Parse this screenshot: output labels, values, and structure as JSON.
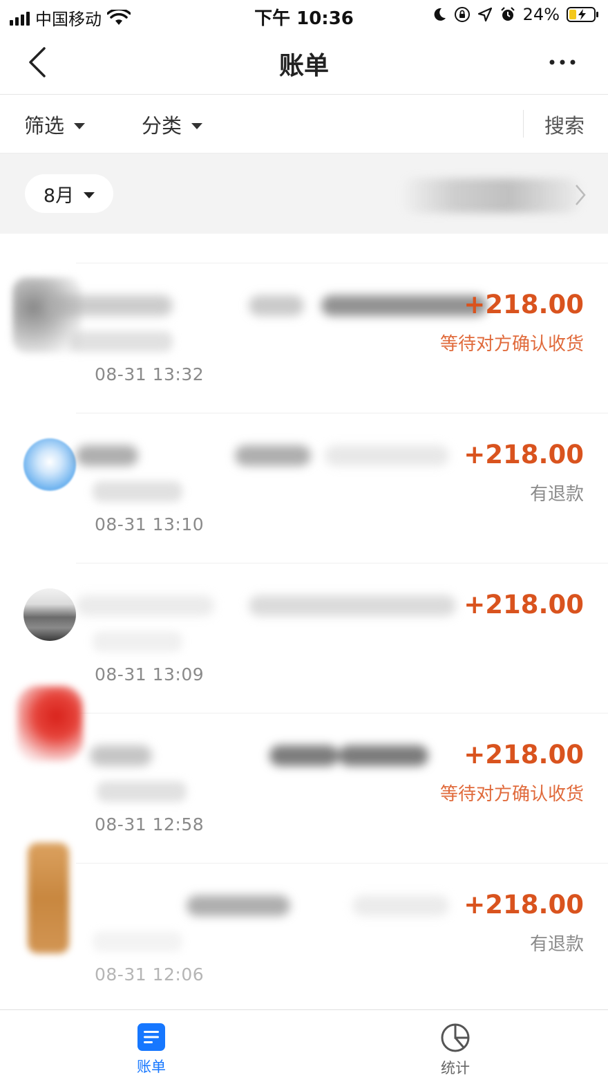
{
  "status_bar": {
    "carrier": "中国移动",
    "time": "下午 10:36",
    "battery_percent": "24%",
    "icons": [
      "signal-icon",
      "wifi-icon",
      "moon-icon",
      "orientation-lock-icon",
      "location-icon",
      "alarm-icon",
      "battery-icon"
    ]
  },
  "nav": {
    "title": "账单",
    "back_icon": "chevron-left-icon",
    "more_icon": "more-dots-icon"
  },
  "filter_bar": {
    "filter_label": "筛选",
    "category_label": "分类",
    "search_label": "搜索"
  },
  "month_bar": {
    "month": "8月"
  },
  "transactions": [
    {
      "amount": "+218.00",
      "status": "等待对方确认收货",
      "status_tone": "orange",
      "time": "08-31  13:32"
    },
    {
      "amount": "+218.00",
      "status": "有退款",
      "status_tone": "grey",
      "time": "08-31  13:10"
    },
    {
      "amount": "+218.00",
      "status": "",
      "status_tone": "none",
      "time": "08-31  13:09"
    },
    {
      "amount": "+218.00",
      "status": "等待对方确认收货",
      "status_tone": "orange",
      "time": "08-31  12:58"
    },
    {
      "amount": "+218.00",
      "status": "有退款",
      "status_tone": "grey",
      "time": "08-31  12:06"
    }
  ],
  "tab_bar": {
    "tabs": [
      {
        "label": "账单",
        "icon": "bill-list-icon",
        "active": true
      },
      {
        "label": "统计",
        "icon": "pie-chart-icon",
        "active": false
      }
    ]
  },
  "colors": {
    "amount": "#d9531e",
    "status_orange": "#e06a3b",
    "status_grey": "#8a8a8a",
    "accent_blue": "#1677ff",
    "month_bar_bg": "#f3f3f3"
  }
}
